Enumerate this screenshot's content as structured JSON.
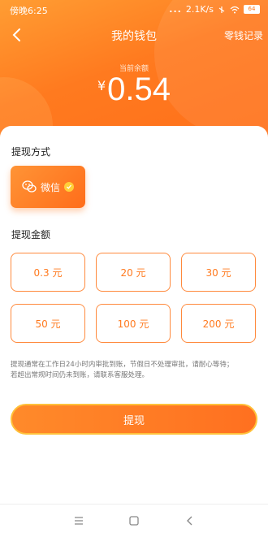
{
  "status_bar": {
    "time": "傍晚6:25",
    "dots": "...",
    "network_speed": "2.1K/s",
    "battery": "64"
  },
  "nav": {
    "title": "我的钱包",
    "records_link": "零钱记录"
  },
  "balance": {
    "label": "当前余额",
    "currency": "¥",
    "amount": "0.54"
  },
  "withdraw_method": {
    "section_title": "提现方式",
    "selected": {
      "label": "微信",
      "icon": "wechat-icon"
    }
  },
  "withdraw_amount": {
    "section_title": "提现金额",
    "options": [
      "0.3 元",
      "20 元",
      "30 元",
      "50 元",
      "100 元",
      "200 元"
    ]
  },
  "notice": {
    "line1": "提现通常在工作日24小时内审批到账，节假日不处理审批，请耐心等待；",
    "line2": "若超出常规时间仍未到账，请联系客服处理。"
  },
  "submit_button": "提现",
  "colors": {
    "accent": "#ff7a1f",
    "accent_light": "#ff9d33",
    "badge": "#ffcf3a"
  }
}
